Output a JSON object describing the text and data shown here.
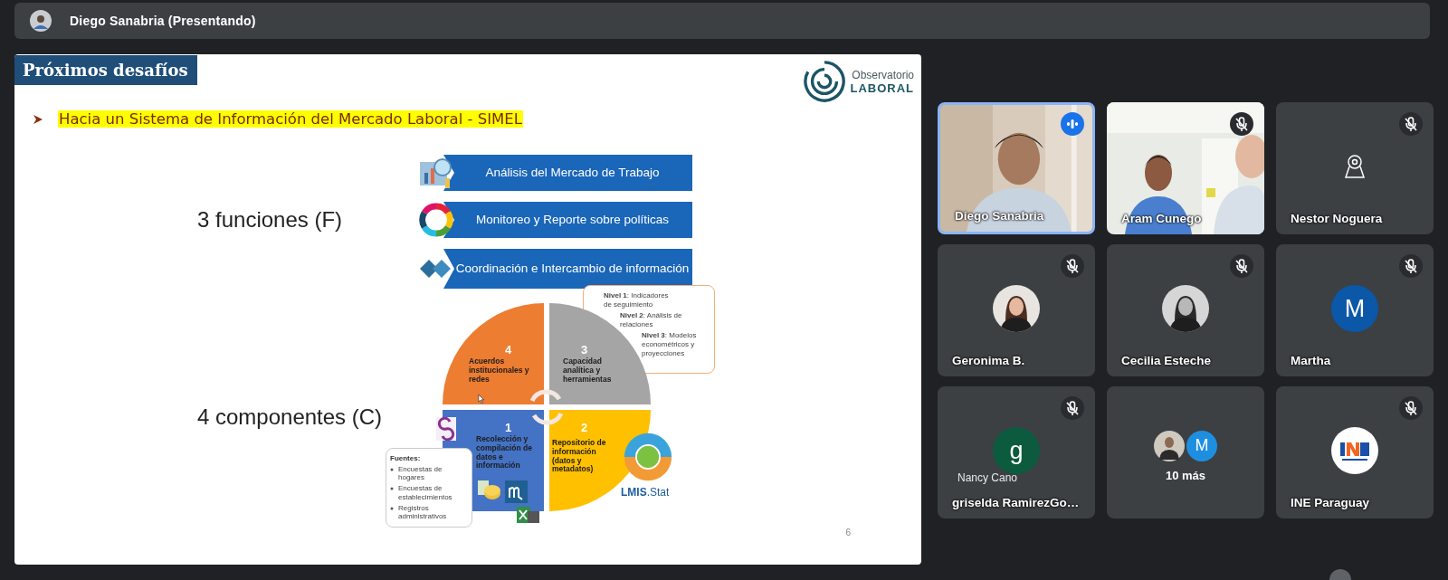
{
  "presenter_bar": {
    "name": "Diego Sanabria (Presentando)"
  },
  "slide": {
    "title": "Próximos desafíos",
    "logo": {
      "line_1": "Observatorio",
      "line_2": "LABORAL"
    },
    "bullet": "Hacia un Sistema de Información del Mercado Laboral - SIMEL",
    "labels": [
      "3 funciones (F)",
      "4 componentes (C)"
    ],
    "functions": [
      "Análisis del Mercado de Trabajo",
      "Monitoreo y Reporte sobre políticas",
      "Coordinación e Intercambio de información"
    ],
    "components": [
      {
        "number": "4",
        "text": "Acuerdos institucionales y redes",
        "color": "#ed7d31"
      },
      {
        "number": "3",
        "text": "Capacidad analítica y herramientas",
        "color": "#a5a5a5"
      },
      {
        "number": "1",
        "text": "Recolección y compilación de datos e información",
        "color": "#4472c4"
      },
      {
        "number": "2",
        "text": "Repositorio de información (datos y metadatos)",
        "color": "#ffc000"
      }
    ],
    "levels": [
      "**Nivel 1**: Indicadores de seguimiento",
      "**Nivel 2**: Análisis de relaciones",
      "**Nivel 3**: Modelos econométricos y proyecciones"
    ],
    "sources": {
      "heading": "Fuentes:",
      "items": [
        "Encuestas de hogares",
        "Encuestas de establecimientos",
        "Registros administrativos"
      ]
    },
    "lmis": "**LMIS**.Stat",
    "page_number": "6"
  },
  "participants": [
    {
      "name": "Diego Sanabria",
      "kind": "video",
      "muted": false,
      "speaking": true
    },
    {
      "name": "Aram Cunego",
      "kind": "video",
      "muted": true,
      "speaking": false
    },
    {
      "name": "Nestor Noguera",
      "kind": "device",
      "muted": true,
      "speaking": false
    },
    {
      "name": "Geronima B.",
      "muted": true,
      "speaking": false
    },
    {
      "name": "Cecilia Esteche",
      "muted": true,
      "speaking": false
    },
    {
      "name": "Martha",
      "kind": "letter",
      "letter": "M",
      "color": "#0b57a8",
      "muted": true,
      "speaking": false
    },
    {
      "name": "griselda RamirezGo…",
      "kind": "letter",
      "letter": "g",
      "color": "#0d5b3f",
      "caption": "Nancy Cano",
      "muted": true,
      "speaking": false
    },
    {
      "name": "10 más",
      "kind": "overflow",
      "letter": "M",
      "color": "#1e8fe0",
      "muted": false,
      "speaking": false
    },
    {
      "name": "INE Paraguay",
      "kind": "logo",
      "muted": true,
      "speaking": false
    }
  ]
}
